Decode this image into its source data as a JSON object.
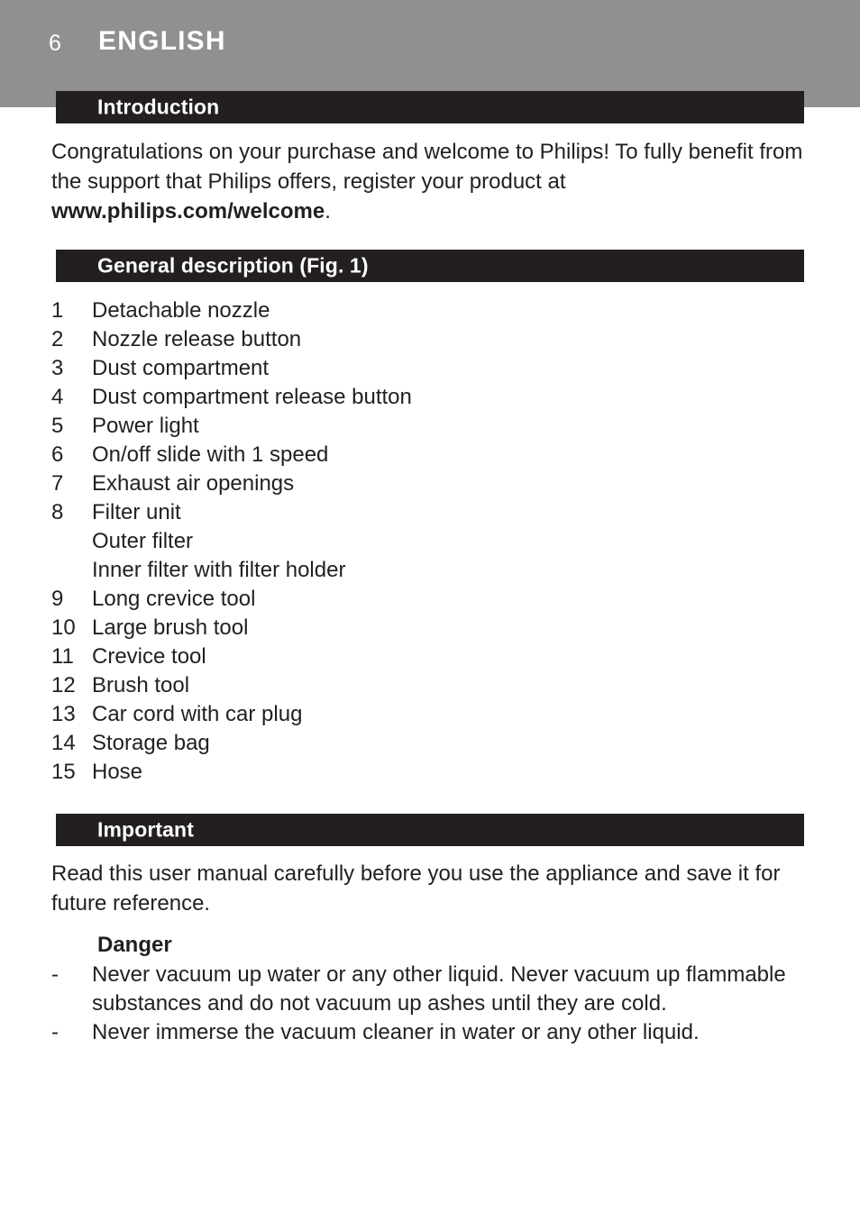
{
  "page": {
    "number": "6",
    "running_title": "ENGLISH",
    "header_bg": "#909090",
    "bar_bg": "#231f20",
    "text_color": "#231f20"
  },
  "sections": {
    "introduction": {
      "title": "Introduction",
      "paragraph_plain": "Congratulations on your purchase and welcome to Philips! To fully benefit from the support that Philips offers, register your product at ",
      "paragraph_bold": "www.philips.com/welcome",
      "paragraph_tail": "."
    },
    "general_description": {
      "title": "General description (Fig. 1)",
      "items": [
        {
          "index": "1",
          "label": "Detachable nozzle"
        },
        {
          "index": "2",
          "label": "Nozzle release button"
        },
        {
          "index": "3",
          "label": "Dust compartment"
        },
        {
          "index": "4",
          "label": "Dust compartment release button"
        },
        {
          "index": "5",
          "label": "Power light"
        },
        {
          "index": "6",
          "label": "On/off slide with 1 speed"
        },
        {
          "index": "7",
          "label": "Exhaust air openings"
        },
        {
          "index": "8",
          "label": "Filter unit"
        },
        {
          "index": "",
          "label": "Outer filter"
        },
        {
          "index": "",
          "label": "Inner filter with filter holder"
        },
        {
          "index": "9",
          "label": "Long crevice tool"
        },
        {
          "index": "10",
          "label": "Large brush tool"
        },
        {
          "index": "11",
          "label": "Crevice tool"
        },
        {
          "index": "12",
          "label": "Brush tool"
        },
        {
          "index": "13",
          "label": "Car cord with car plug"
        },
        {
          "index": "14",
          "label": "Storage bag"
        },
        {
          "index": "15",
          "label": "Hose"
        }
      ]
    },
    "important": {
      "title": "Important",
      "paragraph": "Read this user manual carefully before you use the appliance and save it for future reference.",
      "danger": {
        "heading": "Danger",
        "bullets": [
          {
            "dash": "-",
            "text": "Never vacuum up water or any other liquid. Never vacuum up flammable substances and do not vacuum up ashes until they are cold."
          },
          {
            "dash": "-",
            "text": "Never immerse the vacuum cleaner in water or any other liquid."
          }
        ]
      }
    }
  }
}
